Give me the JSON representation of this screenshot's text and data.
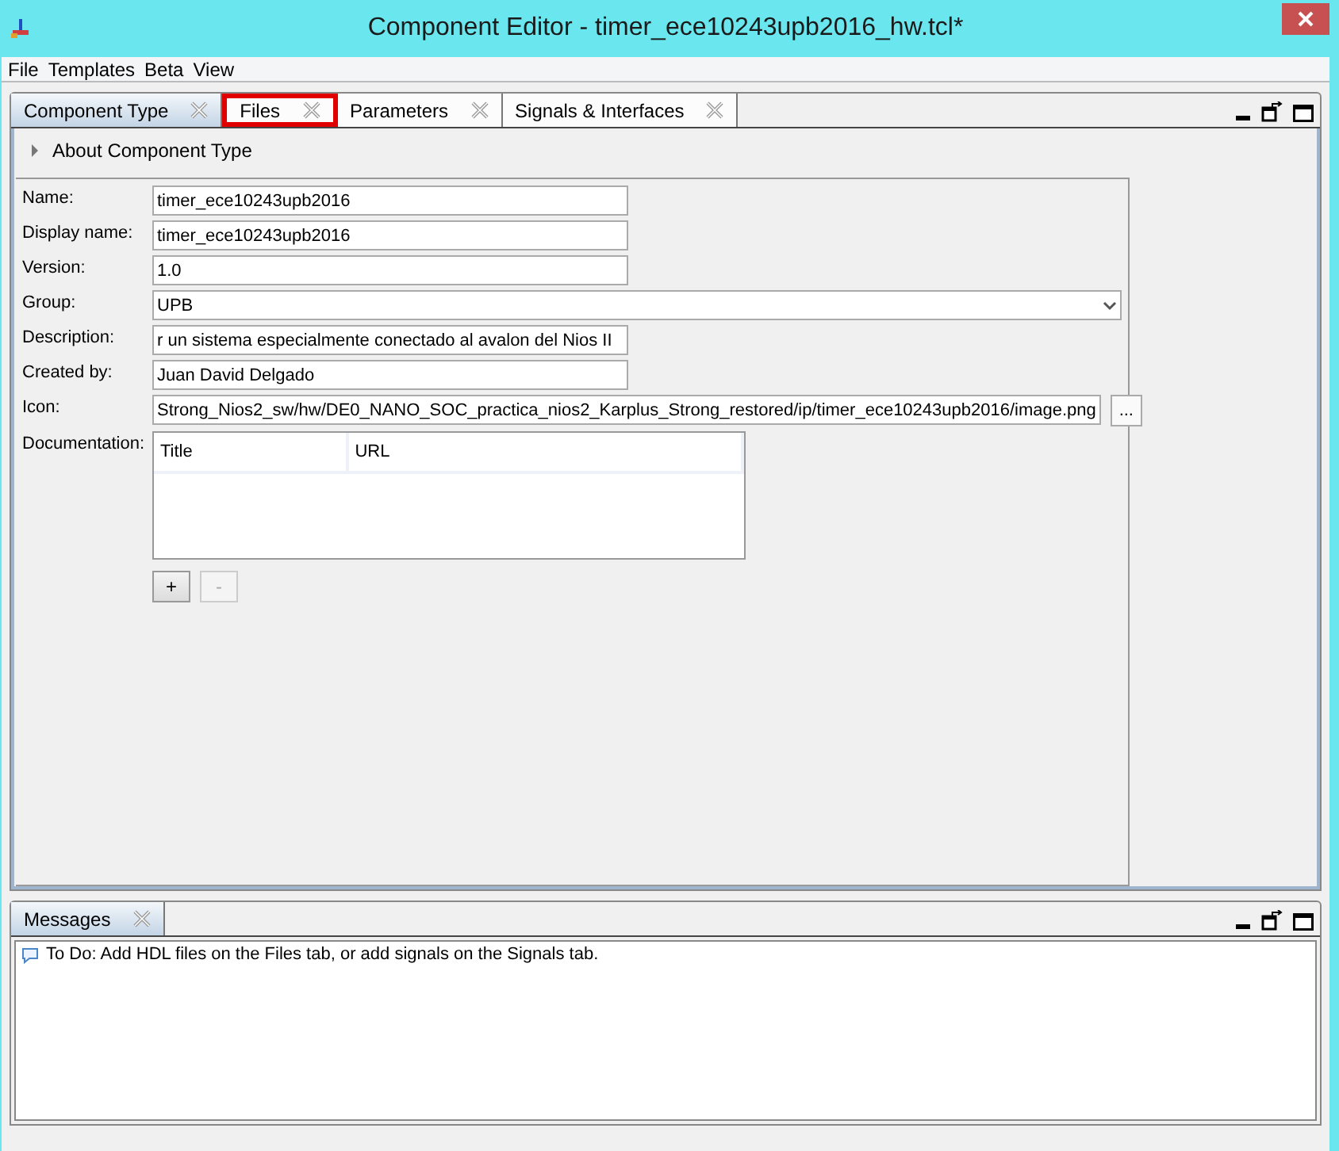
{
  "window": {
    "title": "Component Editor - timer_ece10243upb2016_hw.tcl*"
  },
  "menu": [
    "File",
    "Templates",
    "Beta",
    "View"
  ],
  "tabs": [
    {
      "label": "Component Type",
      "selected": true,
      "highlighted": false
    },
    {
      "label": "Files",
      "selected": false,
      "highlighted": true
    },
    {
      "label": "Parameters",
      "selected": false,
      "highlighted": false
    },
    {
      "label": "Signals & Interfaces",
      "selected": false,
      "highlighted": false
    }
  ],
  "about": {
    "label": "About Component Type",
    "expanded": false
  },
  "fields": [
    {
      "label": "Name:",
      "kind": "text",
      "value": "timer_ece10243upb2016"
    },
    {
      "label": "Display name:",
      "kind": "text",
      "value": "timer_ece10243upb2016"
    },
    {
      "label": "Version:",
      "kind": "text",
      "value": "1.0"
    },
    {
      "label": "Group:",
      "kind": "combo",
      "value": "UPB"
    },
    {
      "label": "Description:",
      "kind": "text",
      "value": "r un sistema especialmente conectado al avalon del Nios II"
    },
    {
      "label": "Created by:",
      "kind": "text",
      "value": "Juan David Delgado"
    },
    {
      "label": "Icon:",
      "kind": "browse",
      "value": "Strong_Nios2_sw/hw/DE0_NANO_SOC_practica_nios2_Karplus_Strong_restored/ip/timer_ece10243upb2016/image.png",
      "button": "..."
    }
  ],
  "documentation": {
    "label": "Documentation:",
    "columns": [
      "Title",
      "URL"
    ],
    "buttons": [
      {
        "label": "+",
        "disabled": false
      },
      {
        "label": "-",
        "disabled": true
      }
    ]
  },
  "messages": {
    "tab": "Messages",
    "items": [
      "To Do: Add HDL files on the Files tab, or add signals on the Signals tab."
    ]
  }
}
